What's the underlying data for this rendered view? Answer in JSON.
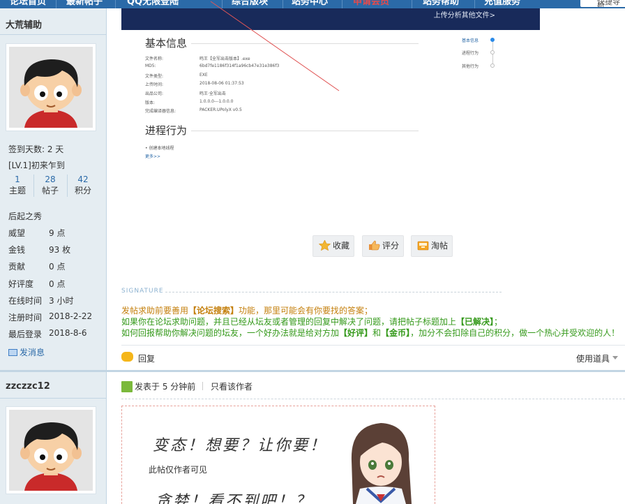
{
  "topnav": {
    "items": [
      "论坛首页",
      "最新帖子",
      "QQ无限登陆",
      "综合版块",
      "站务中心",
      "申请会员",
      "站务帮助",
      "充值服务"
    ],
    "search_placeholder": "快捷导航"
  },
  "post1": {
    "author": "大荒辅助",
    "signin_days": "签到天数: 2 天",
    "level": "[LV.1]初来乍到",
    "stats": [
      {
        "num": "1",
        "label": "主题"
      },
      {
        "num": "28",
        "label": "帖子"
      },
      {
        "num": "42",
        "label": "积分"
      }
    ],
    "group": "后起之秀",
    "profile": [
      {
        "k": "威望",
        "v": "9 点"
      },
      {
        "k": "金钱",
        "v": "93 枚"
      },
      {
        "k": "贡献",
        "v": "0 点"
      },
      {
        "k": "好评度",
        "v": "0 点"
      },
      {
        "k": "在线时间",
        "v": "3 小时"
      },
      {
        "k": "注册时间",
        "v": "2018-2-22"
      },
      {
        "k": "最后登录",
        "v": "2018-8-6"
      }
    ],
    "send_message": "发消息"
  },
  "screenshot": {
    "upload_text": "上传分析其他文件>",
    "basic_title": "基本信息",
    "rows": [
      {
        "k": "文件名称:",
        "v": "鸣王【全军出击版本】.exe"
      },
      {
        "k": "MD5:",
        "v": "6bd7fe1186f314f1a96cb47e31e386f3"
      },
      {
        "k": "文件类型:",
        "v": "EXE"
      },
      {
        "k": "上传时间:",
        "v": "2018-08-06 01:37:53"
      },
      {
        "k": "出品公司:",
        "v": "鸣王·全军出击"
      },
      {
        "k": "版本:",
        "v": "1.0.0.0---1.0.0.0"
      },
      {
        "k": "完成编译器信息:",
        "v": "PACKER.UPolyX v0.5"
      }
    ],
    "process_title": "进程行为",
    "process_item": "• 创建本地线程",
    "more": "更多>>",
    "side_nav": [
      "基本信息",
      "进程行为",
      "其他行为"
    ]
  },
  "actions": [
    {
      "label": "收藏",
      "icon": "star-icon"
    },
    {
      "label": "评分",
      "icon": "thumb-icon"
    },
    {
      "label": "淘帖",
      "icon": "tray-icon"
    }
  ],
  "signature": {
    "title": "SIGNATURE",
    "line1_a": "发帖求助前要善用",
    "line1_b": "【论坛搜索】",
    "line1_c": "功能，那里可能会有你要找的答案；",
    "line2_a": "如果你在论坛求助问题，并且已经从坛友或者管理的回复中解决了问题，请把帖子标题加上",
    "line2_b": "【已解决】",
    "line2_c": "；",
    "line3_a": "如何回报帮助你解决问题的坛友，一个好办法就是给对方加",
    "line3_b": "【好评】",
    "line3_c": "和",
    "line3_d": "【金币】",
    "line3_e": "，加分不会扣除自己的积分，做一个热心并受欢迎的人！"
  },
  "reply_bar": {
    "reply": "回复",
    "tools": "使用道具"
  },
  "post2": {
    "author": "zzczzc12",
    "posted": "发表于 5 分钟前",
    "only_author": "只看该作者",
    "hand_line1": "变态！想要？让你要！",
    "hidden_note": "此帖仅作者可见",
    "hand_line2": "贪婪！看不到吧！？"
  }
}
